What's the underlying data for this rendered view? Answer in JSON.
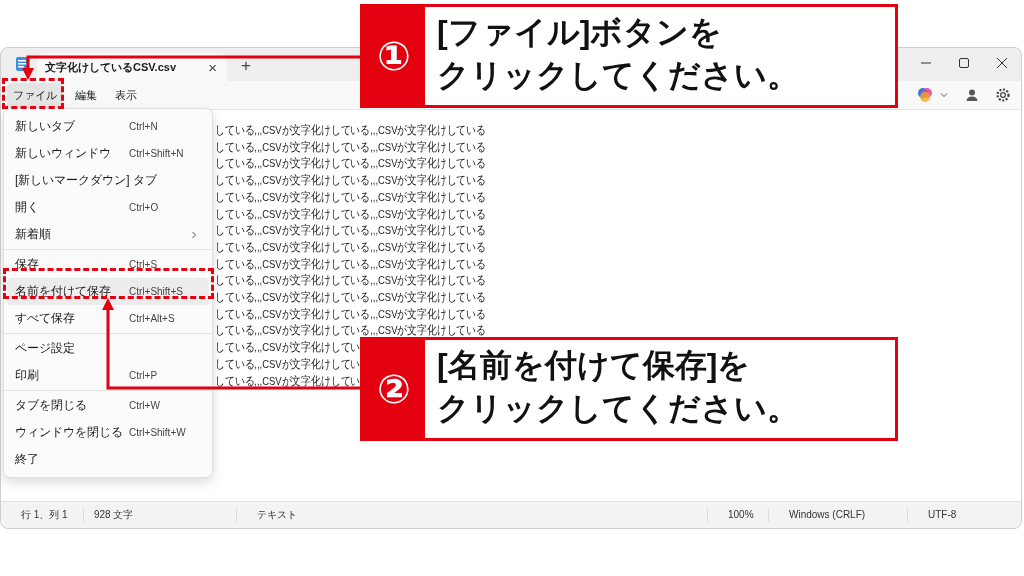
{
  "window": {
    "tab_title": "文字化けしているCSV.csv",
    "tab_close": "×",
    "new_tab": "+"
  },
  "menubar": [
    {
      "label": "ファイル",
      "selected": true
    },
    {
      "label": "編集",
      "selected": false
    },
    {
      "label": "表示",
      "selected": false
    }
  ],
  "file_menu": {
    "groups": [
      [
        {
          "label": "新しいタブ",
          "shortcut": "Ctrl+N",
          "kind": "item",
          "selected": false
        },
        {
          "label": "新しいウィンドウ",
          "shortcut": "Ctrl+Shift+N",
          "kind": "item",
          "selected": false
        },
        {
          "label": "[新しいマークダウン] タブ",
          "kind": "item",
          "selected": false
        },
        {
          "label": "開く",
          "shortcut": "Ctrl+O",
          "kind": "item",
          "selected": false
        },
        {
          "label": "新着順",
          "kind": "submenu",
          "selected": false
        }
      ],
      [
        {
          "label": "保存",
          "shortcut": "Ctrl+S",
          "kind": "item",
          "selected": false
        },
        {
          "label": "名前を付けて保存",
          "shortcut": "Ctrl+Shift+S",
          "kind": "item",
          "selected": true
        },
        {
          "label": "すべて保存",
          "shortcut": "Ctrl+Alt+S",
          "kind": "item",
          "selected": false
        }
      ],
      [
        {
          "label": "ページ設定",
          "kind": "item",
          "selected": false
        },
        {
          "label": "印刷",
          "shortcut": "Ctrl+P",
          "kind": "item",
          "selected": false
        }
      ],
      [
        {
          "label": "タブを閉じる",
          "shortcut": "Ctrl+W",
          "kind": "item",
          "selected": false
        },
        {
          "label": "ウィンドウを閉じる",
          "shortcut": "Ctrl+Shift+W",
          "kind": "item",
          "selected": false
        },
        {
          "label": "終了",
          "kind": "item",
          "selected": false
        }
      ]
    ]
  },
  "editor_lines": [
    "している,,,CSVが文字化けしている,,,CSVが文字化けしている",
    "している,,,CSVが文字化けしている,,,CSVが文字化けしている",
    "している,,,CSVが文字化けしている,,,CSVが文字化けしている",
    "している,,,CSVが文字化けしている,,,CSVが文字化けしている",
    "している,,,CSVが文字化けしている,,,CSVが文字化けしている",
    "している,,,CSVが文字化けしている,,,CSVが文字化けしている",
    "している,,,CSVが文字化けしている,,,CSVが文字化けしている",
    "している,,,CSVが文字化けしている,,,CSVが文字化けしている",
    "している,,,CSVが文字化けしている,,,CSVが文字化けしている",
    "している,,,CSVが文字化けしている,,,CSVが文字化けしている",
    "している,,,CSVが文字化けしている,,,CSVが文字化けしている",
    "している,,,CSVが文字化けしている,,,CSVが文字化けしている",
    "している,,,CSVが文字化けしている,,,CSVが文字化けしている",
    "している,,,CSVが文字化けしてい",
    "している,,,CSVが文字化けしてい",
    "している,,,CSVが文字化けしてい"
  ],
  "status_bar": [
    "行 1、列 1",
    "928 文字",
    "テキスト",
    "100%",
    "Windows (CRLF)",
    "UTF-8"
  ],
  "callouts": [
    {
      "number": "①",
      "lines": [
        "[ファイル]ボタンを",
        "クリックしてください。"
      ]
    },
    {
      "number": "②",
      "lines": [
        "[名前を付けて保存]を",
        "クリックしてください。"
      ]
    }
  ]
}
